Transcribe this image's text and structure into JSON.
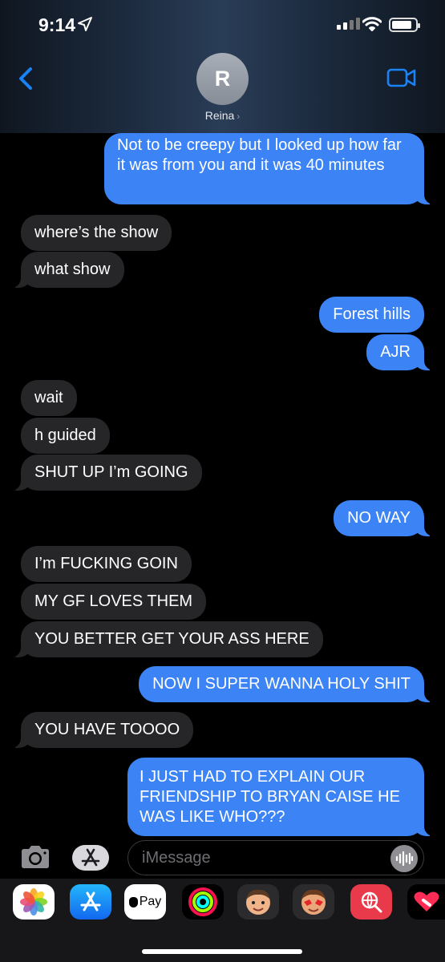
{
  "status_bar": {
    "time": "9:14",
    "location_icon": "location-arrow-icon",
    "signal_icon": "cellular-signal-icon",
    "wifi_icon": "wifi-icon",
    "battery_icon": "battery-icon",
    "battery_level": 0.85
  },
  "header": {
    "back_icon": "chevron-left-icon",
    "avatar_initial": "R",
    "contact_name": "Reina",
    "contact_chevron": "›",
    "video_icon": "video-camera-icon"
  },
  "messages": [
    {
      "from": "me",
      "text": "Not to be creepy but I looked up how far it was from you and it was 40 minutes"
    },
    {
      "from": "them",
      "text": "where’s the show"
    },
    {
      "from": "them",
      "text": "what show"
    },
    {
      "from": "me",
      "text": "Forest hills"
    },
    {
      "from": "me",
      "text": "AJR"
    },
    {
      "from": "them",
      "text": "wait"
    },
    {
      "from": "them",
      "text": "h guided"
    },
    {
      "from": "them",
      "text": "SHUT UP I’m GOING"
    },
    {
      "from": "me",
      "text": "NO WAY"
    },
    {
      "from": "them",
      "text": "I’m FUCKING GOIN"
    },
    {
      "from": "them",
      "text": "MY GF LOVES THEM"
    },
    {
      "from": "them",
      "text": "YOU BETTER GET YOUR ASS HERE"
    },
    {
      "from": "me",
      "text": "NOW I SUPER WANNA HOLY SHIT"
    },
    {
      "from": "them",
      "text": "YOU HAVE TOOOO"
    },
    {
      "from": "me",
      "text": "I JUST HAD TO EXPLAIN OUR FRIENDSHIP TO BRYAN CAISE HE WAS LIKE WHO???"
    }
  ],
  "input_bar": {
    "camera_icon": "camera-icon",
    "apps_icon": "app-store-icon",
    "placeholder": "iMessage",
    "value": "",
    "audio_icon": "audio-waveform-icon"
  },
  "app_tray": {
    "items": [
      {
        "name": "photos-app-icon"
      },
      {
        "name": "app-store-app-icon"
      },
      {
        "name": "apple-pay-app-icon",
        "label": "Pay"
      },
      {
        "name": "activity-app-icon"
      },
      {
        "name": "memoji-app-icon"
      },
      {
        "name": "animoji-app-icon"
      },
      {
        "name": "web-search-app-icon"
      },
      {
        "name": "digital-touch-app-icon"
      }
    ]
  },
  "colors": {
    "sent_bubble": "#3c84f6",
    "received_bubble": "#262629",
    "accent": "#1a82f7"
  }
}
